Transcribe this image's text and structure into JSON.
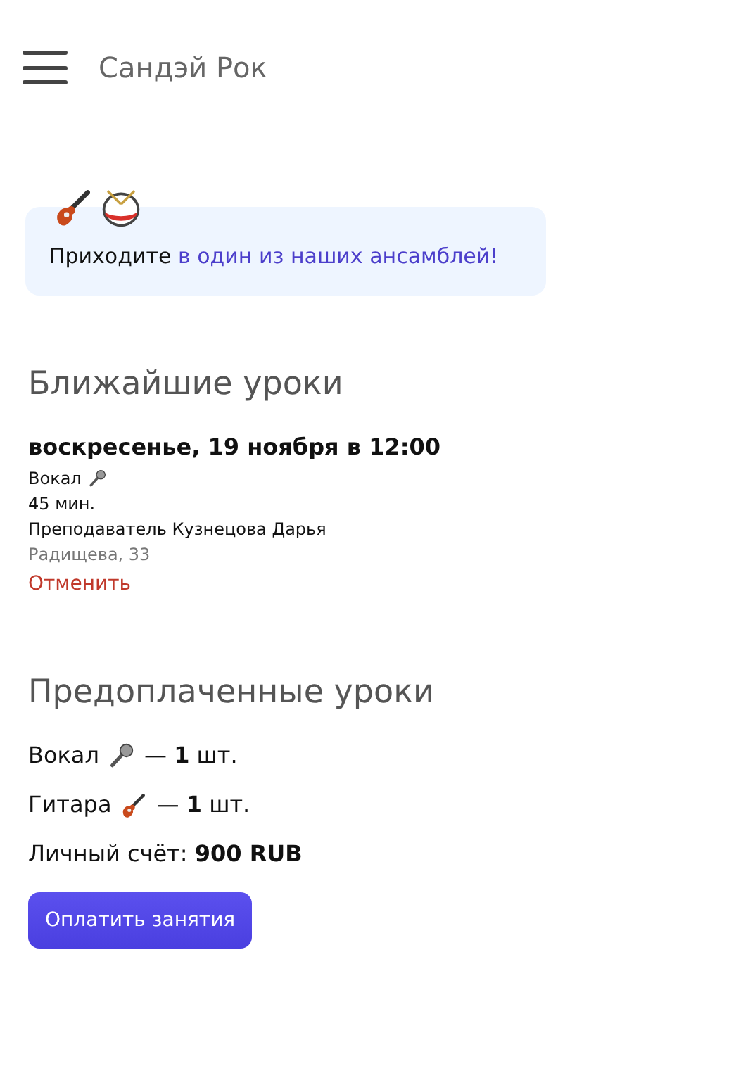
{
  "header": {
    "title": "Сандэй Рок"
  },
  "promo": {
    "icons": [
      {
        "kind": "guitar"
      },
      {
        "kind": "drum"
      }
    ],
    "text": "Приходите",
    "link": "в один из наших ансамблей!"
  },
  "upcoming": {
    "heading": "Ближайшие уроки",
    "lessons": [
      {
        "datetime": "воскресенье, 19 ноября в 12:00",
        "subject": "Вокал",
        "kind": "microphone",
        "duration": "45 мин.",
        "teacher": "Преподаватель Кузнецова Дарья",
        "address": "Радищева, 33",
        "cancel": "Отменить"
      }
    ]
  },
  "prepaid": {
    "heading": "Предоплаченные уроки",
    "items": [
      {
        "name": "Вокал",
        "kind": "microphone",
        "count": "— **1** шт."
      },
      {
        "name": "Гитара",
        "kind": "guitar",
        "count": "— **1** шт."
      }
    ],
    "balance": "Личный счёт: **900 RUB**",
    "pay_button": "Оплатить занятия"
  }
}
